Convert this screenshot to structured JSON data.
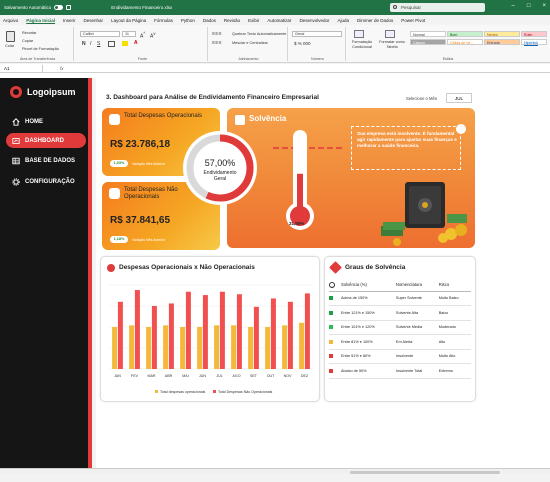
{
  "titlebar": {
    "autosave": "Salvamento Automático",
    "filename": "Endividamento Financeiro.xlsx",
    "search_placeholder": "Pesquisar"
  },
  "menu": [
    "Arquivo",
    "Página Inicial",
    "Inserir",
    "Desenhar",
    "Layout da Página",
    "Fórmulas",
    "Python",
    "Dados",
    "Revisão",
    "Exibir",
    "Automatizar",
    "Desenvolvedor",
    "Ajuda",
    "Dimmer de Dados",
    "Power Pivot"
  ],
  "ribbon": {
    "clipboard": {
      "paste": "Colar",
      "cut": "Recortar",
      "copy": "Copiar",
      "format_painter": "Pincel de Formatação",
      "label": "Área de Transferência"
    },
    "font": {
      "name": "Calibri",
      "size": "11",
      "label": "Fonte"
    },
    "alignment": {
      "wrap": "Quebrar Texto Automaticamente",
      "merge": "Mesclar e Centralizar",
      "label": "Alinhamento"
    },
    "number": {
      "format": "Geral",
      "label": "Número"
    },
    "styles": {
      "conditional": "Formatação Condicional",
      "table": "Formatar como Tabela",
      "cells": [
        "Normal",
        "Bom",
        "Neutro",
        "Ruim",
        "Cálculo",
        "Célula de Ve...",
        "Entrada",
        "Hiperlink"
      ],
      "label": "Estilos"
    }
  },
  "formula_bar": {
    "cell": "A1",
    "fx": "fx"
  },
  "sidebar": {
    "logo": "Logoipsum",
    "items": [
      {
        "label": "HOME"
      },
      {
        "label": "DASHBOARD"
      },
      {
        "label": "BASE DE DADOS"
      },
      {
        "label": "CONFIGURAÇÃO"
      }
    ]
  },
  "dashboard": {
    "title": "3. Dashboard para Análise de Endividamento Financeiro Empresarial",
    "select_label": "Selecione o Mês",
    "select_value": "JUL",
    "card1": {
      "title": "Total Despesas Operacionais",
      "value": "R$ 23.786,18",
      "badge": "1,03%",
      "badge_label": "Variação Mês Anterior"
    },
    "card2": {
      "title": "Total Despesas Não Operacionais",
      "value": "R$ 37.841,65",
      "badge": "1,18%",
      "badge_label": "Variação Mês Anterior"
    },
    "gauge": {
      "value": "57,00%",
      "label": "Endividamento Geral",
      "fraction": 0.57
    },
    "solvencia": {
      "title": "Solvência",
      "message": "Sua empresa está insolvente. É fundamental agir rapidamente para ajustar suas finanças e melhorar a saúde financeira.",
      "thermo_value": "31,50%",
      "fraction": 0.315
    }
  },
  "chart_data": {
    "type": "bar",
    "title": "Despesas Operacionais x Não Operacionais",
    "categories": [
      "JAN",
      "FEV",
      "MAR",
      "ABR",
      "MAI",
      "JUN",
      "JUL",
      "AGO",
      "SET",
      "OUT",
      "NOV",
      "DEZ"
    ],
    "series": [
      {
        "name": "Total despesas operacionais",
        "color": "#f4b93a",
        "values": [
          50,
          52,
          50,
          52,
          50,
          50,
          52,
          52,
          50,
          50,
          52,
          55
        ]
      },
      {
        "name": "Total Despesas Não Operacionais",
        "color": "#f25050",
        "values": [
          80,
          94,
          75,
          78,
          92,
          88,
          92,
          89,
          74,
          84,
          80,
          90
        ]
      }
    ],
    "ylim": [
      0,
      100
    ],
    "legend": "bottom"
  },
  "graus": {
    "title": "Graus de Solvência",
    "headers": [
      "Solvência (%)",
      "Nomenclatura",
      "Risco"
    ],
    "rows": [
      {
        "color": "#1e9e4a",
        "range": "Acima de 150%",
        "name": "Super Solvente",
        "risk": "Muito Baixo"
      },
      {
        "color": "#1e9e4a",
        "range": "Entre 121% e 150%",
        "name": "Solvente Alta",
        "risk": "Baixo"
      },
      {
        "color": "#2fb85a",
        "range": "Entre 101% e 120%",
        "name": "Solvente Média",
        "risk": "Moderado"
      },
      {
        "color": "#f4b93a",
        "range": "Entre 81% e 100%",
        "name": "Em Alerta",
        "risk": "Alto"
      },
      {
        "color": "#e03a3a",
        "range": "Entre 51% e 80%",
        "name": "Insolvente",
        "risk": "Muito Alto"
      },
      {
        "color": "#e03a3a",
        "range": "Abaixo de 50%",
        "name": "Insolvente Total",
        "risk": "Extremo"
      }
    ]
  }
}
